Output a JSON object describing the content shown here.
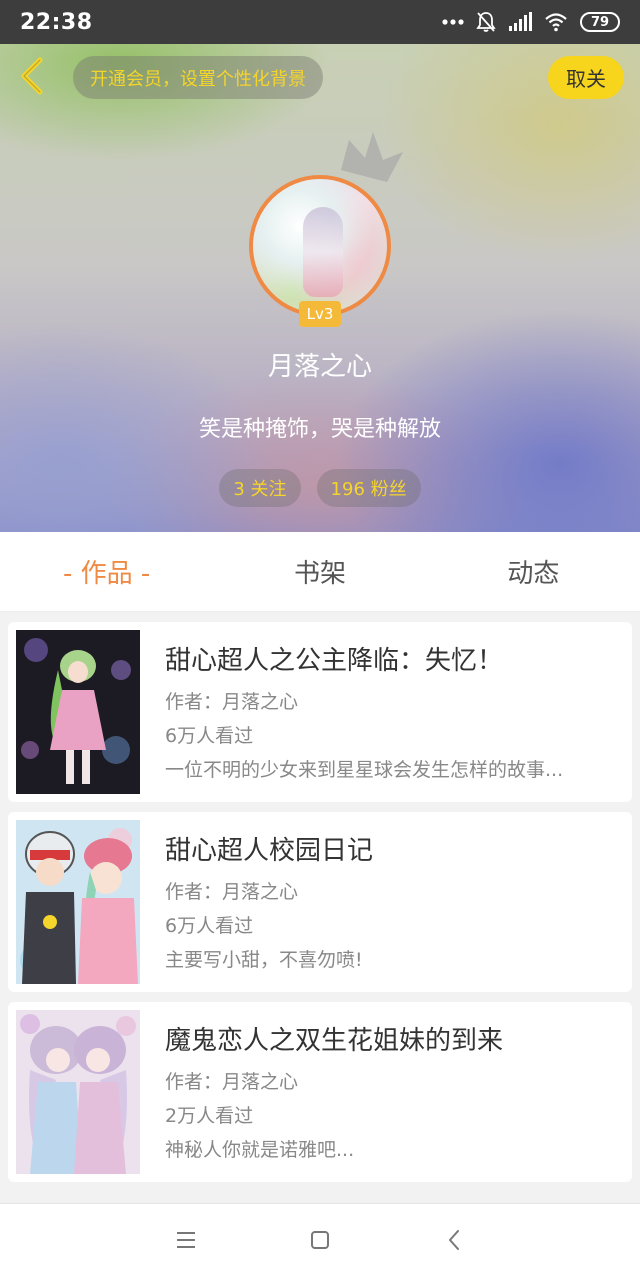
{
  "status_bar": {
    "time": "22:38",
    "battery": "79",
    "icons": [
      "more-dots-icon",
      "mute-bell-icon",
      "signal-icon",
      "wifi-icon",
      "battery-icon"
    ]
  },
  "header": {
    "vip_prompt": "开通会员，设置个性化背景",
    "unfollow_label": "取关",
    "level": "Lv3",
    "username": "月落之心",
    "signature": "笑是种掩饰，哭是种解放",
    "following": "3 关注",
    "followers": "196 粉丝"
  },
  "tabs": [
    {
      "label": "- 作品 -",
      "active": true
    },
    {
      "label": "书架",
      "active": false
    },
    {
      "label": "动态",
      "active": false
    }
  ],
  "works": [
    {
      "title": "甜心超人之公主降临：失忆！",
      "author": "作者：月落之心",
      "views": "6万人看过",
      "description": "一位不明的少女来到星星球会发生怎样的故事..."
    },
    {
      "title": "甜心超人校园日记",
      "author": "作者：月落之心",
      "views": "6万人看过",
      "description": "主要写小甜，不喜勿喷!"
    },
    {
      "title": "魔鬼恋人之双生花姐妹的到来",
      "author": "作者：月落之心",
      "views": "2万人看过",
      "description": "神秘人你就是诺雅吧..."
    }
  ],
  "colors": {
    "accent": "#ef8a45",
    "highlight_yellow": "#f5d42c",
    "status_bar_bg": "#3d3d3d"
  }
}
